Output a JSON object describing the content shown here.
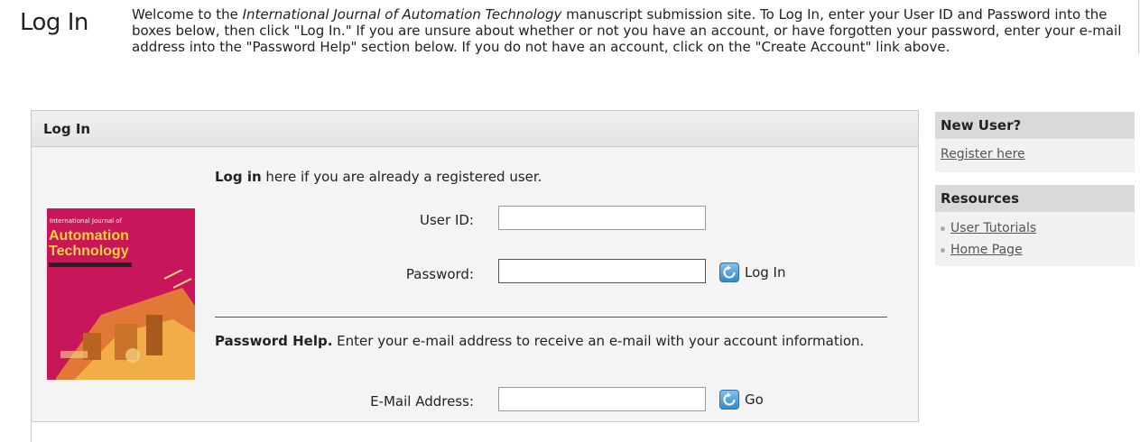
{
  "page": {
    "heading": "Log In",
    "intro_pre": "Welcome to the ",
    "intro_journal": "International Journal of Automation Technology",
    "intro_post": " manuscript submission site. To Log In, enter your User ID and Password into the boxes below, then click \"Log In.\" If you are unsure about whether or not you have an account, or have forgotten your password, enter your e-mail address into the \"Password Help\" section below. If you do not have an account, click on the \"Create Account\" link above."
  },
  "login_panel": {
    "title": "Log In",
    "intro_bold": "Log in",
    "intro_rest": " here if you are already a registered user.",
    "user_id_label": "User ID:",
    "user_id_value": "",
    "password_label": "Password:",
    "password_value": "",
    "login_button": "Log In",
    "help_bold": "Password Help.",
    "help_rest": " Enter your e-mail address to receive an e-mail with your account information.",
    "email_label": "E-Mail Address:",
    "email_value": "",
    "go_button": "Go"
  },
  "cover": {
    "tag": "International Journal of",
    "title_line1": "Automation",
    "title_line2": "Technology"
  },
  "sidebar": {
    "new_user_header": "New User?",
    "register_link": "Register here",
    "resources_header": "Resources",
    "resources": [
      {
        "label": "User Tutorials"
      },
      {
        "label": "Home Page"
      }
    ]
  },
  "colors": {
    "cover_bg": "#c9155a",
    "cover_title": "#ffd33b",
    "button_blue": "#3a88c8",
    "panel_bg": "#f4f4f4",
    "sidebar_header_bg": "#d9d9d9"
  },
  "icons": {
    "login_button_icon": "refresh-arrow-icon",
    "go_button_icon": "refresh-arrow-icon",
    "bullet_icon": "bullet-dot-icon"
  }
}
